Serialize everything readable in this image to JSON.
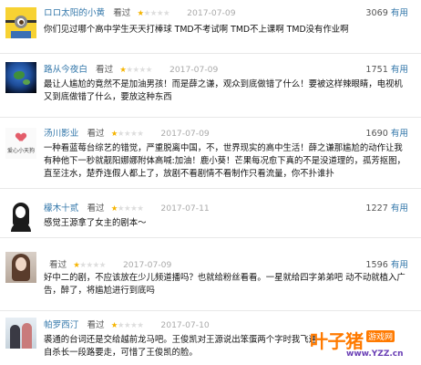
{
  "reviews": [
    {
      "user": "ロロ太阳的小黄",
      "seen": "看过",
      "rating": 1,
      "date": "2017-07-09",
      "votes": "3069",
      "useful_label": "有用",
      "avatar_icon": "minion-avatar",
      "lines": [
        "你们见过哪个高中学生天天打棒球 TMD不考试啊 TMD不上课啊 TMD没有作业啊"
      ]
    },
    {
      "user": "路从今夜白",
      "seen": "看过",
      "rating": 1,
      "date": "2017-07-09",
      "votes": "1751",
      "useful_label": "有用",
      "avatar_icon": "earth-avatar",
      "lines": [
        "最让人尴尬的竟然不是加油男孩！而是薛之谦，观众到底做错了什么！要被这样辣眼睛，电视机又到底做错了什么，要放这种东西"
      ]
    },
    {
      "user": "汤川影业",
      "seen": "看过",
      "rating": 1,
      "date": "2017-07-09",
      "votes": "1690",
      "useful_label": "有用",
      "avatar_icon": "sketch-avatar",
      "avatar_caption": "爱心小天狗",
      "lines": [
        "一种看蓝莓台综艺的错觉，严重脱离中国，不，世界现实的高中生活！薛之谦那尴尬的动作让我有种他下一秒就靓阳娜娜附体高喊:加油！鹿小葵！芒果每况愈下真的不是没道理的，孤芳抠图，直至注水，楚乔连假人都上了，放剧不看剧情不看制作只看流量，你不扑谁扑"
      ]
    },
    {
      "user": "檬木十贰",
      "seen": "看过",
      "rating": 1,
      "date": "2017-07-11",
      "votes": "1227",
      "useful_label": "有用",
      "avatar_icon": "girl-silhouette-avatar",
      "lines": [
        "感觉王源拿了女主的剧本～"
      ]
    },
    {
      "user": "",
      "seen": "看过",
      "rating": 1,
      "date": "2017-07-09",
      "votes": "1596",
      "useful_label": "有用",
      "avatar_icon": "photo-avatar",
      "lines": [
        "好中二的剧，不应该放在少儿频道播吗？也就给粉丝看看。一星就给四字弟弟吧 动不动就植入广告，醉了，将尴尬进行到底吗"
      ]
    },
    {
      "user": "帕罗西汀",
      "seen": "看过",
      "rating": 1,
      "date": "2017-07-10",
      "votes": "",
      "useful_label": "",
      "avatar_icon": "couple-avatar",
      "lines": [
        "裘通的台词还是交给越前龙马吧。王俊凯对王源说出笨蛋两个字时我飞速自杀长一段路要走，可惜了王俊凯的脸。"
      ]
    }
  ],
  "watermark": {
    "logo": "叶子猪",
    "sub": "游戏网",
    "url": "www.YZZ.cn"
  },
  "colors": {
    "user_link": "#3377aa",
    "star_on": "#f5b400",
    "star_off": "#dddddd",
    "watermark_orange": "#ff7a00"
  }
}
